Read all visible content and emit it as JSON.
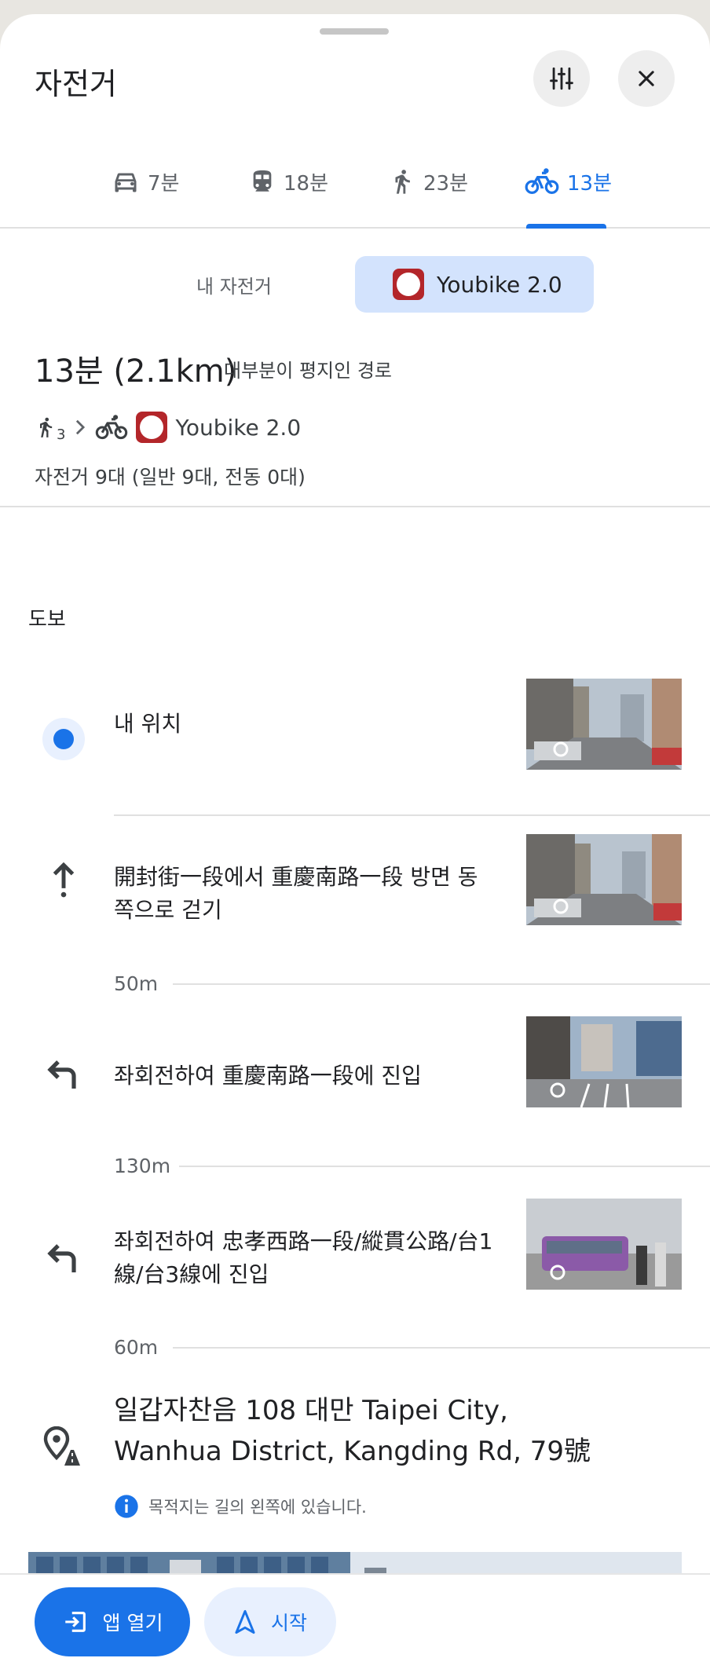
{
  "header": {
    "title": "자전거"
  },
  "tabs": [
    {
      "label": "7분",
      "icon": "car-icon"
    },
    {
      "label": "18분",
      "icon": "train-icon"
    },
    {
      "label": "23분",
      "icon": "walk-icon"
    },
    {
      "label": "13분",
      "icon": "bike-icon",
      "active": true
    }
  ],
  "bike_options": {
    "own": "내 자전거",
    "share": "Youbike 2.0"
  },
  "summary": {
    "time_distance": "13분 (2.1km)",
    "note": "대부분이 평지인 경로",
    "walk_count": "3",
    "service": "Youbike 2.0",
    "bikes_available": "자전거 9대 (일반 9대, 전동 0대)"
  },
  "section_label": "도보",
  "steps": [
    {
      "text": "내 위치",
      "icon": "my-location-icon"
    },
    {
      "text": "開封街一段에서 重慶南路一段 방면 동쪽으로 걷기",
      "icon": "arrow-up-icon",
      "distance_after": "50m"
    },
    {
      "text": "좌회전하여 重慶南路一段에 진입",
      "icon": "turn-left-icon",
      "distance_after": "130m"
    },
    {
      "text": "좌회전하여 忠孝西路一段/縱貫公路/台1線/台3線에 진입",
      "icon": "turn-left-icon",
      "distance_after": "60m"
    }
  ],
  "destination": {
    "text": "일갑자찬음 108 대만 Taipei City, Wanhua District, Kangding Rd, 79號",
    "info": "목적지는 길의 왼쪽에 있습니다."
  },
  "actions": {
    "open_app": "앱 열기",
    "start": "시작"
  },
  "colors": {
    "accent": "#1a73e8",
    "active_segment": "#d3e3fd",
    "youbike": "#b3262a"
  }
}
